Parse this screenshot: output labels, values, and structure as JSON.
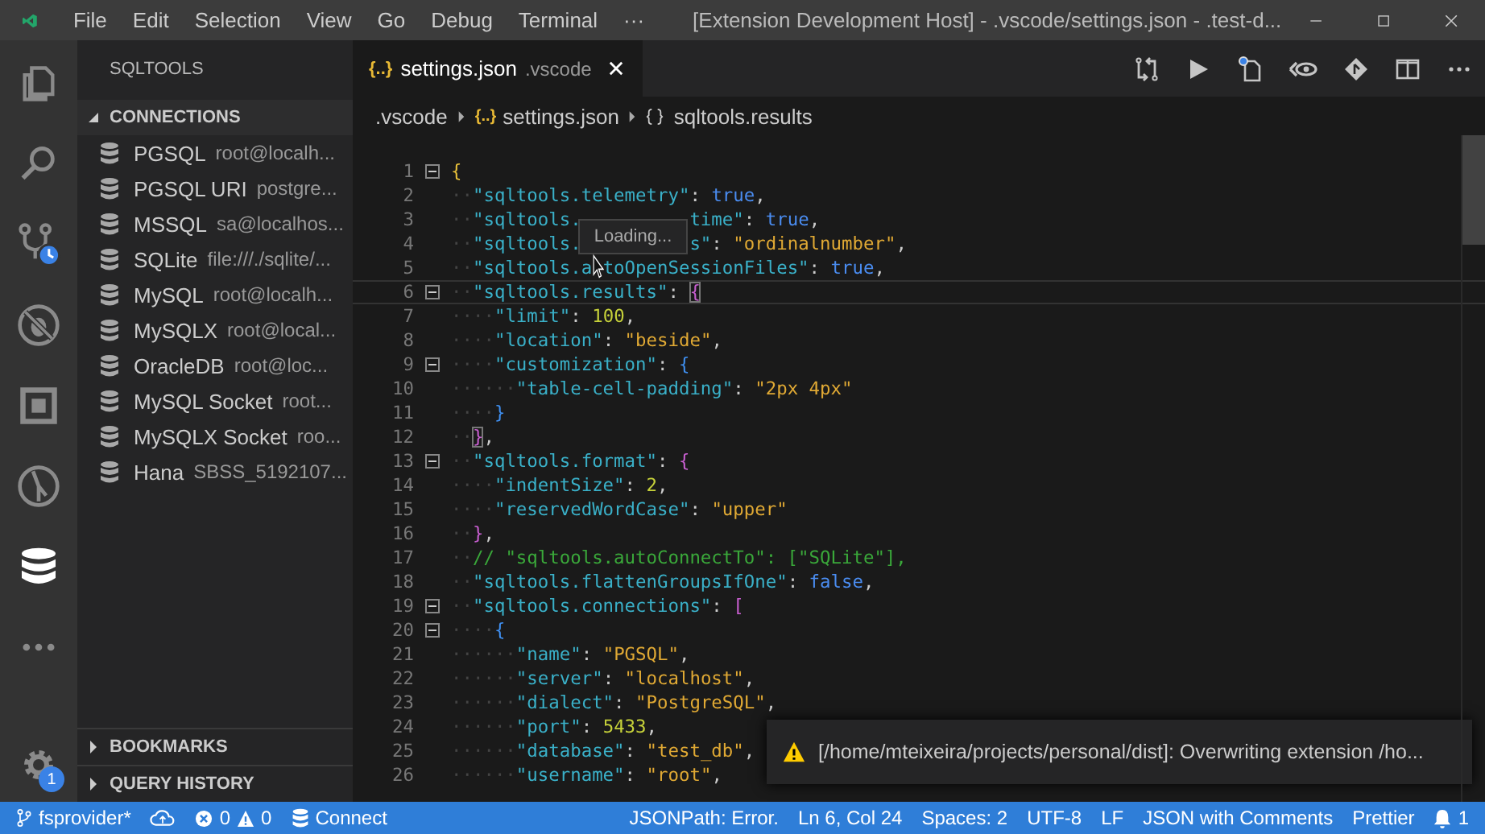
{
  "window": {
    "title": "[Extension Development Host] - .vscode/settings.json - .test-d..."
  },
  "menu": [
    "File",
    "Edit",
    "Selection",
    "View",
    "Go",
    "Debug",
    "Terminal",
    "···"
  ],
  "activity_bar": [
    {
      "kind": "files",
      "selected": false
    },
    {
      "kind": "search",
      "selected": false
    },
    {
      "kind": "scm",
      "selected": false
    },
    {
      "kind": "debug",
      "selected": false
    },
    {
      "kind": "extensions",
      "selected": false
    },
    {
      "kind": "git",
      "selected": false
    },
    {
      "kind": "database",
      "selected": true
    },
    {
      "kind": "more",
      "selected": false
    }
  ],
  "settings_badge": "1",
  "sidebar": {
    "title": "SQLTOOLS",
    "sections": [
      {
        "label": "CONNECTIONS",
        "expanded": true,
        "items": [
          {
            "name": "PGSQL",
            "detail": "root@localh..."
          },
          {
            "name": "PGSQL URI",
            "detail": "postgre..."
          },
          {
            "name": "MSSQL",
            "detail": "sa@localhos..."
          },
          {
            "name": "SQLite",
            "detail": "file:///./sqlite/..."
          },
          {
            "name": "MySQL",
            "detail": "root@localh..."
          },
          {
            "name": "MySQLX",
            "detail": "root@local..."
          },
          {
            "name": "OracleDB",
            "detail": "root@loc..."
          },
          {
            "name": "MySQL Socket",
            "detail": "root..."
          },
          {
            "name": "MySQLX Socket",
            "detail": "roo..."
          },
          {
            "name": "Hana",
            "detail": "SBSS_5192107..."
          }
        ]
      },
      {
        "label": "BOOKMARKS",
        "expanded": false
      },
      {
        "label": "QUERY HISTORY",
        "expanded": false
      }
    ]
  },
  "tab": {
    "icon": "{..}",
    "label": "settings.json",
    "folder": ".vscode",
    "selected": true
  },
  "breadcrumbs": [
    {
      "kind": "folder",
      "label": ".vscode"
    },
    {
      "kind": "json",
      "icon": "{..}",
      "label": "settings.json"
    },
    {
      "kind": "object",
      "label": "sqltools.results"
    }
  ],
  "editor": {
    "lines": [
      {
        "n": "1",
        "fold": true,
        "active": false,
        "t": [
          {
            "kind": "b1",
            "text": "{"
          }
        ]
      },
      {
        "n": "2",
        "fold": false,
        "active": false,
        "t": [
          {
            "kind": "ws",
            "text": "··"
          },
          {
            "kind": "key",
            "text": "\"sqltools.telemetry\""
          },
          {
            "kind": "p",
            "text": ": "
          },
          {
            "kind": "bool",
            "text": "true"
          },
          {
            "kind": "p",
            "text": ","
          }
        ]
      },
      {
        "n": "3",
        "fold": false,
        "active": false,
        "t": [
          {
            "kind": "ws",
            "text": "··"
          },
          {
            "kind": "key",
            "text": "\"sqltools."
          },
          {
            "kind": "key_after_hover",
            "text": "time\""
          },
          {
            "kind": "p",
            "text": ": "
          },
          {
            "kind": "bool",
            "text": "true"
          },
          {
            "kind": "p",
            "text": ","
          }
        ]
      },
      {
        "n": "4",
        "fold": false,
        "active": false,
        "t": [
          {
            "kind": "ws",
            "text": "··"
          },
          {
            "kind": "key",
            "text": "\"sqltools."
          },
          {
            "kind": "key_after_hover",
            "text": "s\""
          },
          {
            "kind": "p",
            "text": ": "
          },
          {
            "kind": "str",
            "text": "\"ordinalnumber\""
          },
          {
            "kind": "p",
            "text": ","
          }
        ]
      },
      {
        "n": "5",
        "fold": false,
        "active": false,
        "t": [
          {
            "kind": "ws",
            "text": "··"
          },
          {
            "kind": "key",
            "text": "\"sqltools.a"
          },
          {
            "kind": "key_after_pointer",
            "text": "toOpenSessionFiles\""
          },
          {
            "kind": "p",
            "text": ": "
          },
          {
            "kind": "bool",
            "text": "true"
          },
          {
            "kind": "p",
            "text": ","
          }
        ]
      },
      {
        "n": "6",
        "fold": true,
        "active": true,
        "t": [
          {
            "kind": "ws",
            "text": "··"
          },
          {
            "kind": "key",
            "text": "\"sqltools.results\""
          },
          {
            "kind": "p",
            "text": ": "
          },
          {
            "kind": "b2m",
            "text": "{"
          }
        ]
      },
      {
        "n": "7",
        "fold": false,
        "active": false,
        "t": [
          {
            "kind": "ws",
            "text": "····"
          },
          {
            "kind": "key",
            "text": "\"limit\""
          },
          {
            "kind": "p",
            "text": ": "
          },
          {
            "kind": "num",
            "text": "100"
          },
          {
            "kind": "p",
            "text": ","
          }
        ]
      },
      {
        "n": "8",
        "fold": false,
        "active": false,
        "t": [
          {
            "kind": "ws",
            "text": "····"
          },
          {
            "kind": "key",
            "text": "\"location\""
          },
          {
            "kind": "p",
            "text": ": "
          },
          {
            "kind": "str",
            "text": "\"beside\""
          },
          {
            "kind": "p",
            "text": ","
          }
        ]
      },
      {
        "n": "9",
        "fold": true,
        "active": false,
        "t": [
          {
            "kind": "ws",
            "text": "····"
          },
          {
            "kind": "key",
            "text": "\"customization\""
          },
          {
            "kind": "p",
            "text": ": "
          },
          {
            "kind": "b3",
            "text": "{"
          }
        ]
      },
      {
        "n": "10",
        "fold": false,
        "active": false,
        "t": [
          {
            "kind": "ws",
            "text": "······"
          },
          {
            "kind": "key",
            "text": "\"table-cell-padding\""
          },
          {
            "kind": "p",
            "text": ": "
          },
          {
            "kind": "str",
            "text": "\"2px 4px\""
          }
        ]
      },
      {
        "n": "11",
        "fold": false,
        "active": false,
        "t": [
          {
            "kind": "ws",
            "text": "····"
          },
          {
            "kind": "b3",
            "text": "}"
          }
        ]
      },
      {
        "n": "12",
        "fold": false,
        "active": false,
        "t": [
          {
            "kind": "ws",
            "text": "··"
          },
          {
            "kind": "b2m",
            "text": "}"
          },
          {
            "kind": "p",
            "text": ","
          }
        ]
      },
      {
        "n": "13",
        "fold": true,
        "active": false,
        "t": [
          {
            "kind": "ws",
            "text": "··"
          },
          {
            "kind": "key",
            "text": "\"sqltools.format\""
          },
          {
            "kind": "p",
            "text": ": "
          },
          {
            "kind": "b2",
            "text": "{"
          }
        ]
      },
      {
        "n": "14",
        "fold": false,
        "active": false,
        "t": [
          {
            "kind": "ws",
            "text": "····"
          },
          {
            "kind": "key",
            "text": "\"indentSize\""
          },
          {
            "kind": "p",
            "text": ": "
          },
          {
            "kind": "num",
            "text": "2"
          },
          {
            "kind": "p",
            "text": ","
          }
        ]
      },
      {
        "n": "15",
        "fold": false,
        "active": false,
        "t": [
          {
            "kind": "ws",
            "text": "····"
          },
          {
            "kind": "key",
            "text": "\"reservedWordCase\""
          },
          {
            "kind": "p",
            "text": ": "
          },
          {
            "kind": "str",
            "text": "\"upper\""
          }
        ]
      },
      {
        "n": "16",
        "fold": false,
        "active": false,
        "t": [
          {
            "kind": "ws",
            "text": "··"
          },
          {
            "kind": "b2",
            "text": "}"
          },
          {
            "kind": "p",
            "text": ","
          }
        ]
      },
      {
        "n": "17",
        "fold": false,
        "active": false,
        "t": [
          {
            "kind": "ws",
            "text": "··"
          },
          {
            "kind": "comment",
            "text": "// \"sqltools.autoConnectTo\": [\"SQLite\"],"
          }
        ]
      },
      {
        "n": "18",
        "fold": false,
        "active": false,
        "t": [
          {
            "kind": "ws",
            "text": "··"
          },
          {
            "kind": "key",
            "text": "\"sqltools.flattenGroupsIfOne\""
          },
          {
            "kind": "p",
            "text": ": "
          },
          {
            "kind": "bool",
            "text": "false"
          },
          {
            "kind": "p",
            "text": ","
          }
        ]
      },
      {
        "n": "19",
        "fold": true,
        "active": false,
        "t": [
          {
            "kind": "ws",
            "text": "··"
          },
          {
            "kind": "key",
            "text": "\"sqltools.connections\""
          },
          {
            "kind": "p",
            "text": ": "
          },
          {
            "kind": "b2",
            "text": "["
          }
        ]
      },
      {
        "n": "20",
        "fold": true,
        "active": false,
        "t": [
          {
            "kind": "ws",
            "text": "····"
          },
          {
            "kind": "b3",
            "text": "{"
          }
        ]
      },
      {
        "n": "21",
        "fold": false,
        "active": false,
        "t": [
          {
            "kind": "ws",
            "text": "······"
          },
          {
            "kind": "key",
            "text": "\"name\""
          },
          {
            "kind": "p",
            "text": ": "
          },
          {
            "kind": "str",
            "text": "\"PGSQL\""
          },
          {
            "kind": "p",
            "text": ","
          }
        ]
      },
      {
        "n": "22",
        "fold": false,
        "active": false,
        "t": [
          {
            "kind": "ws",
            "text": "······"
          },
          {
            "kind": "key",
            "text": "\"server\""
          },
          {
            "kind": "p",
            "text": ": "
          },
          {
            "kind": "str",
            "text": "\"localhost\""
          },
          {
            "kind": "p",
            "text": ","
          }
        ]
      },
      {
        "n": "23",
        "fold": false,
        "active": false,
        "t": [
          {
            "kind": "ws",
            "text": "······"
          },
          {
            "kind": "key",
            "text": "\"dialect\""
          },
          {
            "kind": "p",
            "text": ": "
          },
          {
            "kind": "str",
            "text": "\"PostgreSQL\""
          },
          {
            "kind": "p",
            "text": ","
          }
        ]
      },
      {
        "n": "24",
        "fold": false,
        "active": false,
        "t": [
          {
            "kind": "ws",
            "text": "······"
          },
          {
            "kind": "key",
            "text": "\"port\""
          },
          {
            "kind": "p",
            "text": ": "
          },
          {
            "kind": "num",
            "text": "5433"
          },
          {
            "kind": "p",
            "text": ","
          }
        ]
      },
      {
        "n": "25",
        "fold": false,
        "active": false,
        "t": [
          {
            "kind": "ws",
            "text": "······"
          },
          {
            "kind": "key",
            "text": "\"database\""
          },
          {
            "kind": "p",
            "text": ": "
          },
          {
            "kind": "str",
            "text": "\"test_db\""
          },
          {
            "kind": "p",
            "text": ","
          }
        ]
      },
      {
        "n": "26",
        "fold": false,
        "active": false,
        "t": [
          {
            "kind": "ws",
            "text": "······"
          },
          {
            "kind": "key",
            "text": "\"username\""
          },
          {
            "kind": "p",
            "text": ": "
          },
          {
            "kind": "str",
            "text": "\"root\""
          },
          {
            "kind": "p",
            "text": ","
          }
        ]
      }
    ],
    "hover": "Loading..."
  },
  "notification": {
    "kind": "warning",
    "text": "[/home/mteixeira/projects/personal/dist]: Overwriting extension /ho..."
  },
  "status_bar": {
    "left": [
      {
        "kind": "branch",
        "label": "fsprovider*"
      },
      {
        "kind": "sync"
      },
      {
        "kind": "problems",
        "errors": "0",
        "warnings": "0"
      },
      {
        "kind": "db",
        "label": "Connect"
      }
    ],
    "right": [
      {
        "kind": "text",
        "label": "JSONPath: Error."
      },
      {
        "kind": "text",
        "label": "Ln 6, Col 24"
      },
      {
        "kind": "text",
        "label": "Spaces: 2"
      },
      {
        "kind": "text",
        "label": "UTF-8"
      },
      {
        "kind": "text",
        "label": "LF"
      },
      {
        "kind": "text",
        "label": "JSON with Comments"
      },
      {
        "kind": "text",
        "label": "Prettier"
      },
      {
        "kind": "bell",
        "label": "1"
      }
    ]
  }
}
